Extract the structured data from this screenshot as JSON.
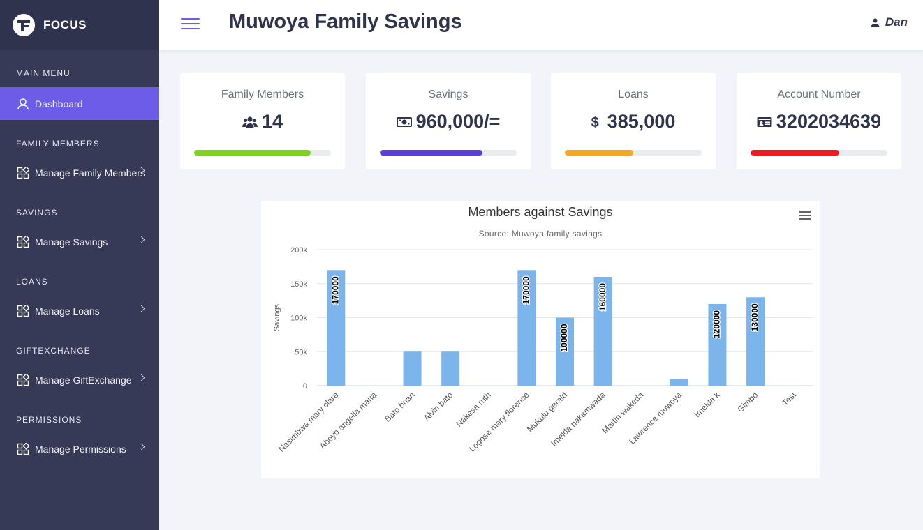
{
  "brand": {
    "name": "FOCUS"
  },
  "header": {
    "title": "Muwoya Family Savings",
    "user": "Dan"
  },
  "sidebar": {
    "sections": [
      {
        "title": "MAIN MENU",
        "item": "Dashboard"
      },
      {
        "title": "FAMILY MEMBERS",
        "item": "Manage Family Members"
      },
      {
        "title": "SAVINGS",
        "item": "Manage Savings"
      },
      {
        "title": "LOANS",
        "item": "Manage Loans"
      },
      {
        "title": "GIFTEXCHANGE",
        "item": "Manage GiftExchange"
      },
      {
        "title": "PERMISSIONS",
        "item": "Manage Permissions"
      }
    ]
  },
  "cards": [
    {
      "title": "Family Members",
      "value": "14",
      "icon": "users-icon",
      "progress": 0.85,
      "color": "#7ed321"
    },
    {
      "title": "Savings",
      "value": "960,000/=",
      "icon": "money-icon",
      "progress": 0.75,
      "color": "#5b3fd6"
    },
    {
      "title": "Loans",
      "value": "385,000",
      "icon": "dollar-icon",
      "progress": 0.5,
      "color": "#f5a623"
    },
    {
      "title": "Account Number",
      "value": "3202034639",
      "icon": "id-card-icon",
      "progress": 0.65,
      "color": "#ed1c24"
    }
  ],
  "chart_data": {
    "type": "bar",
    "title": "Members against Savings",
    "subtitle": "Source: Muwoya family savings",
    "ylabel": "Savings",
    "ylim": [
      0,
      200000
    ],
    "yticks": [
      "0",
      "50k",
      "100k",
      "150k",
      "200k"
    ],
    "categories": [
      "Nasimbwa mary clare",
      "Aboyo angella maria",
      "Bato brian",
      "Alvin bato",
      "Nakesa ruth",
      "Logose mary florence",
      "Mukulu gerald",
      "Imelda nakamwada",
      "Martin wakeda",
      "Lawrence muwoya",
      "Imelda k",
      "Gimbo",
      "Test"
    ],
    "values": [
      170000,
      0,
      50000,
      50000,
      0,
      170000,
      100000,
      160000,
      0,
      10000,
      120000,
      130000,
      0
    ],
    "data_labels": [
      "170000",
      "",
      "",
      "",
      "",
      "170000",
      "100000",
      "160000",
      "",
      "",
      "120000",
      "130000",
      ""
    ],
    "bar_color": "#7cb5ec"
  }
}
